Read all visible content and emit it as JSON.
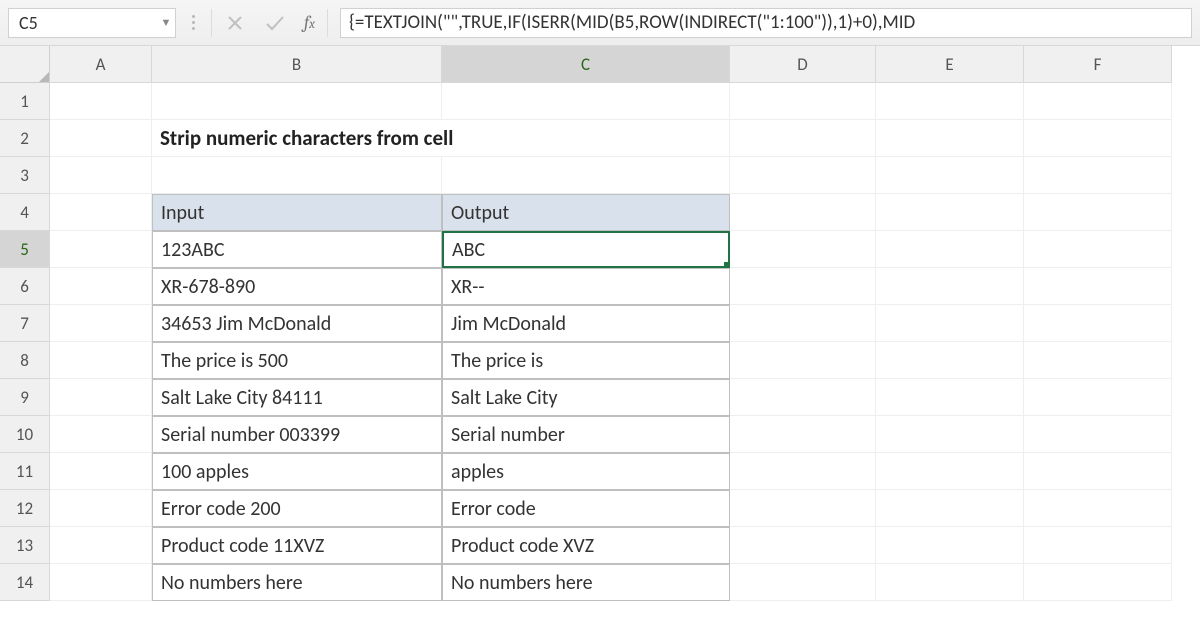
{
  "name_box": {
    "value": "C5"
  },
  "formula_bar": {
    "value": "{=TEXTJOIN(\"\",TRUE,IF(ISERR(MID(B5,ROW(INDIRECT(\"1:100\")),1)+0),MID"
  },
  "columns": [
    "A",
    "B",
    "C",
    "D",
    "E",
    "F"
  ],
  "rows": [
    "1",
    "2",
    "3",
    "4",
    "5",
    "6",
    "7",
    "8",
    "9",
    "10",
    "11",
    "12",
    "13",
    "14"
  ],
  "title": "Strip numeric characters from cell",
  "headers": {
    "input": "Input",
    "output": "Output"
  },
  "data": [
    {
      "input": "123ABC",
      "output": "ABC"
    },
    {
      "input": "XR-678-890",
      "output": "XR--"
    },
    {
      "input": "34653 Jim McDonald",
      "output": " Jim McDonald"
    },
    {
      "input": "The price is 500",
      "output": "The price is "
    },
    {
      "input": "Salt Lake City 84111",
      "output": "Salt Lake City "
    },
    {
      "input": "Serial number 003399",
      "output": "Serial number "
    },
    {
      "input": "100 apples",
      "output": " apples"
    },
    {
      "input": "Error code 200",
      "output": "Error code "
    },
    {
      "input": "Product code 11XVZ",
      "output": "Product code XVZ"
    },
    {
      "input": "No numbers here",
      "output": "No numbers here"
    }
  ],
  "selected": {
    "row": 5,
    "col": "C"
  }
}
